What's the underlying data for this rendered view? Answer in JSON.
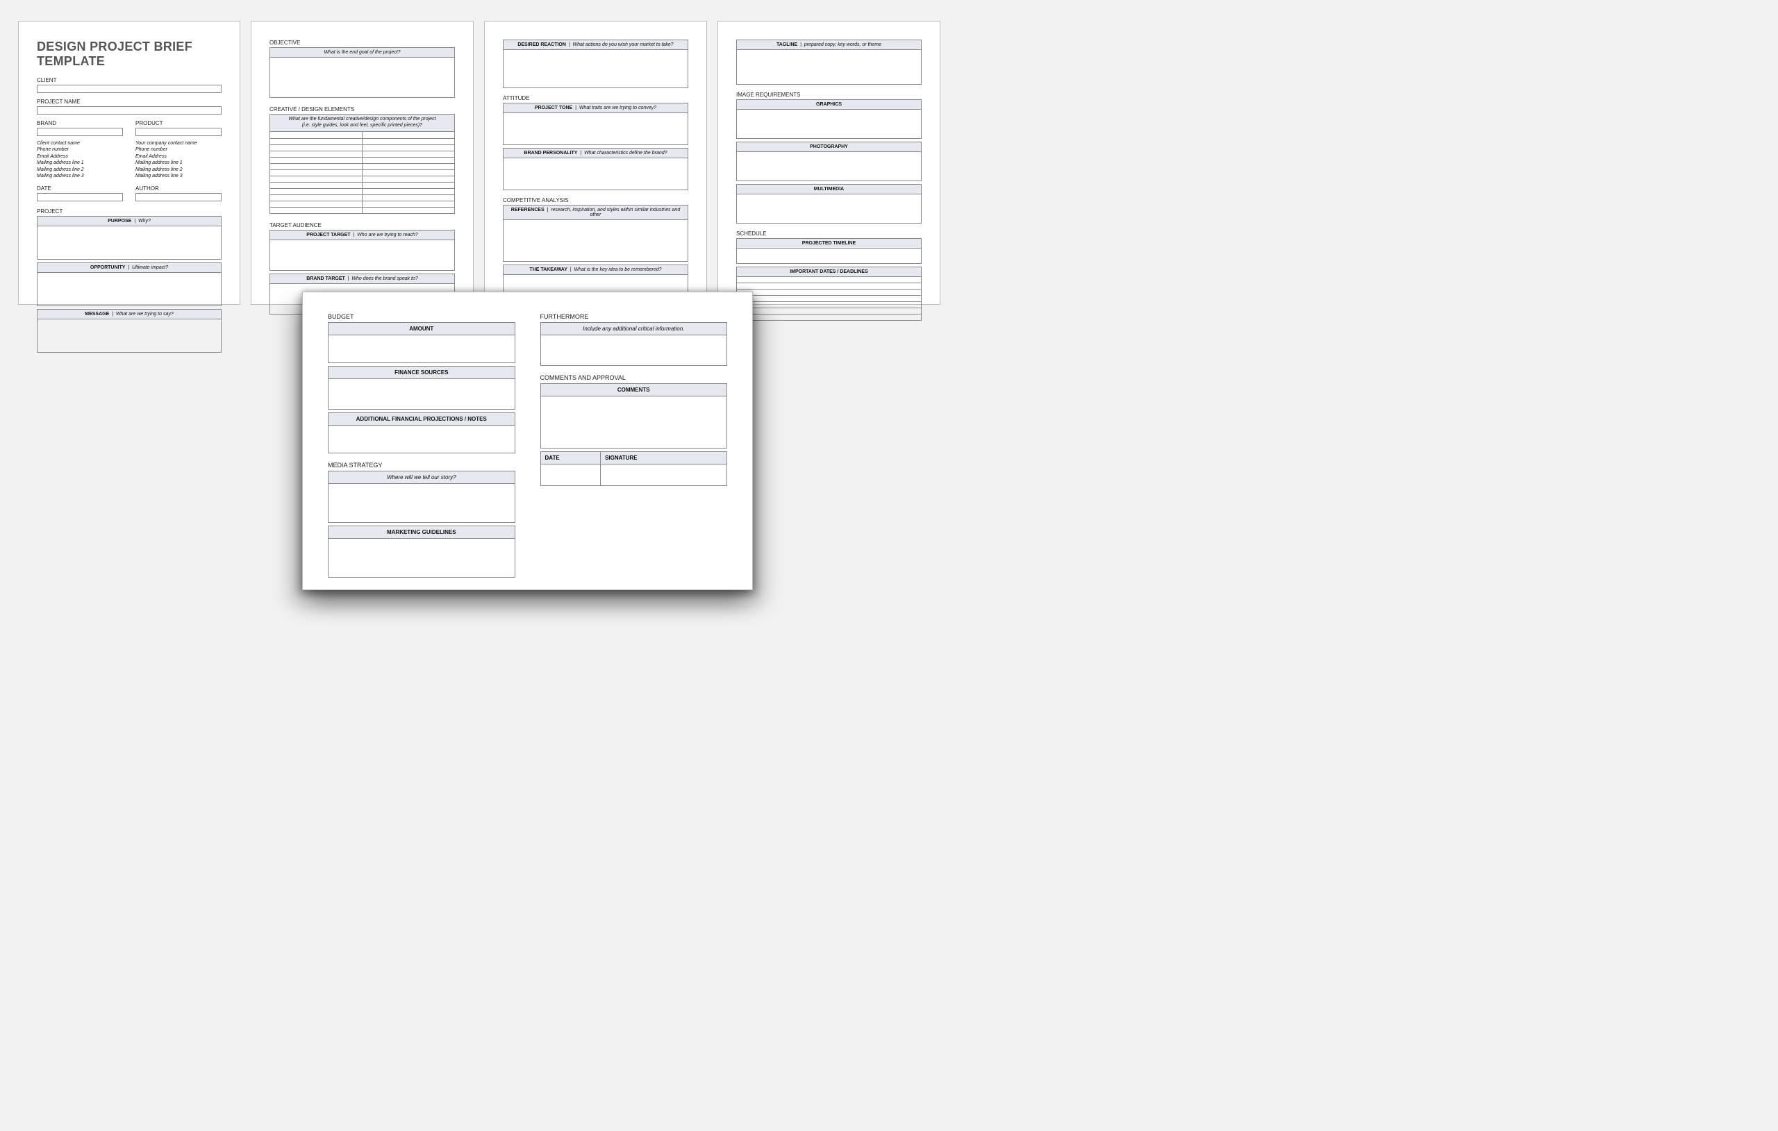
{
  "title": "DESIGN PROJECT BRIEF TEMPLATE",
  "page1": {
    "client": "CLIENT",
    "project_name": "PROJECT NAME",
    "brand": "BRAND",
    "product": "PRODUCT",
    "client_contact": {
      "l1": "Client contact name",
      "l2": "Phone number",
      "l3": "Email Address",
      "l4": "Mailing address line 1",
      "l5": "Mailing address line 2",
      "l6": "Mailing address line 3"
    },
    "company_contact": {
      "l1": "Your company contact name",
      "l2": "Phone number",
      "l3": "Email Address",
      "l4": "Mailing address line 1",
      "l5": "Mailing address line 2",
      "l6": "Mailing address line 3"
    },
    "date": "DATE",
    "author": "AUTHOR",
    "project": "PROJECT",
    "purpose_label": "PURPOSE",
    "purpose_hint": "Why?",
    "opportunity_label": "OPPORTUNITY",
    "opportunity_hint": "Ultimate impact?",
    "message_label": "MESSAGE",
    "message_hint": "What are we trying to say?"
  },
  "page2": {
    "objective": "OBJECTIVE",
    "objective_hint": "What is the end goal of the project?",
    "creative": "CREATIVE / DESIGN ELEMENTS",
    "creative_hint1": "What are the fundamental creative/design components of the project",
    "creative_hint2": "(i.e. style guides, look and feel, specific printed pieces)?",
    "target_audience": "TARGET AUDIENCE",
    "project_target_label": "PROJECT TARGET",
    "project_target_hint": "Who are we trying to reach?",
    "brand_target_label": "BRAND TARGET",
    "brand_target_hint": "Who does the brand speak to?"
  },
  "page3": {
    "desired_reaction_label": "DESIRED REACTION",
    "desired_reaction_hint": "What actions do you wish your market to take?",
    "attitude": "ATTITUDE",
    "project_tone_label": "PROJECT TONE",
    "project_tone_hint": "What traits are we trying to convey?",
    "brand_personality_label": "BRAND PERSONALITY",
    "brand_personality_hint": "What characteristics define the brand?",
    "competitive": "COMPETITIVE ANALYSIS",
    "references_label": "REFERENCES",
    "references_hint": "research, inspiration, and styles within similar industries and other",
    "takeaway_label": "THE TAKEAWAY",
    "takeaway_hint": "What is the key idea to be remembered?"
  },
  "page4": {
    "tagline_label": "TAGLINE",
    "tagline_hint": "prepared copy, key words, or theme",
    "image_req": "IMAGE REQUIREMENTS",
    "graphics": "GRAPHICS",
    "photography": "PHOTOGRAPHY",
    "multimedia": "MULTIMEDIA",
    "schedule": "SCHEDULE",
    "projected_timeline": "PROJECTED TIMELINE",
    "important_dates": "IMPORTANT DATES / DEADLINES"
  },
  "page5": {
    "budget": "BUDGET",
    "amount": "AMOUNT",
    "finance_sources": "FINANCE SOURCES",
    "additional_financial": "ADDITIONAL FINANCIAL PROJECTIONS / NOTES",
    "media_strategy": "MEDIA STRATEGY",
    "media_hint": "Where will we tell our story?",
    "marketing_guidelines": "MARKETING GUIDELINES",
    "furthermore": "FURTHERMORE",
    "furthermore_hint": "Include any additional critical information.",
    "comments_approval": "COMMENTS AND APPROVAL",
    "comments": "COMMENTS",
    "date": "DATE",
    "signature": "SIGNATURE"
  }
}
